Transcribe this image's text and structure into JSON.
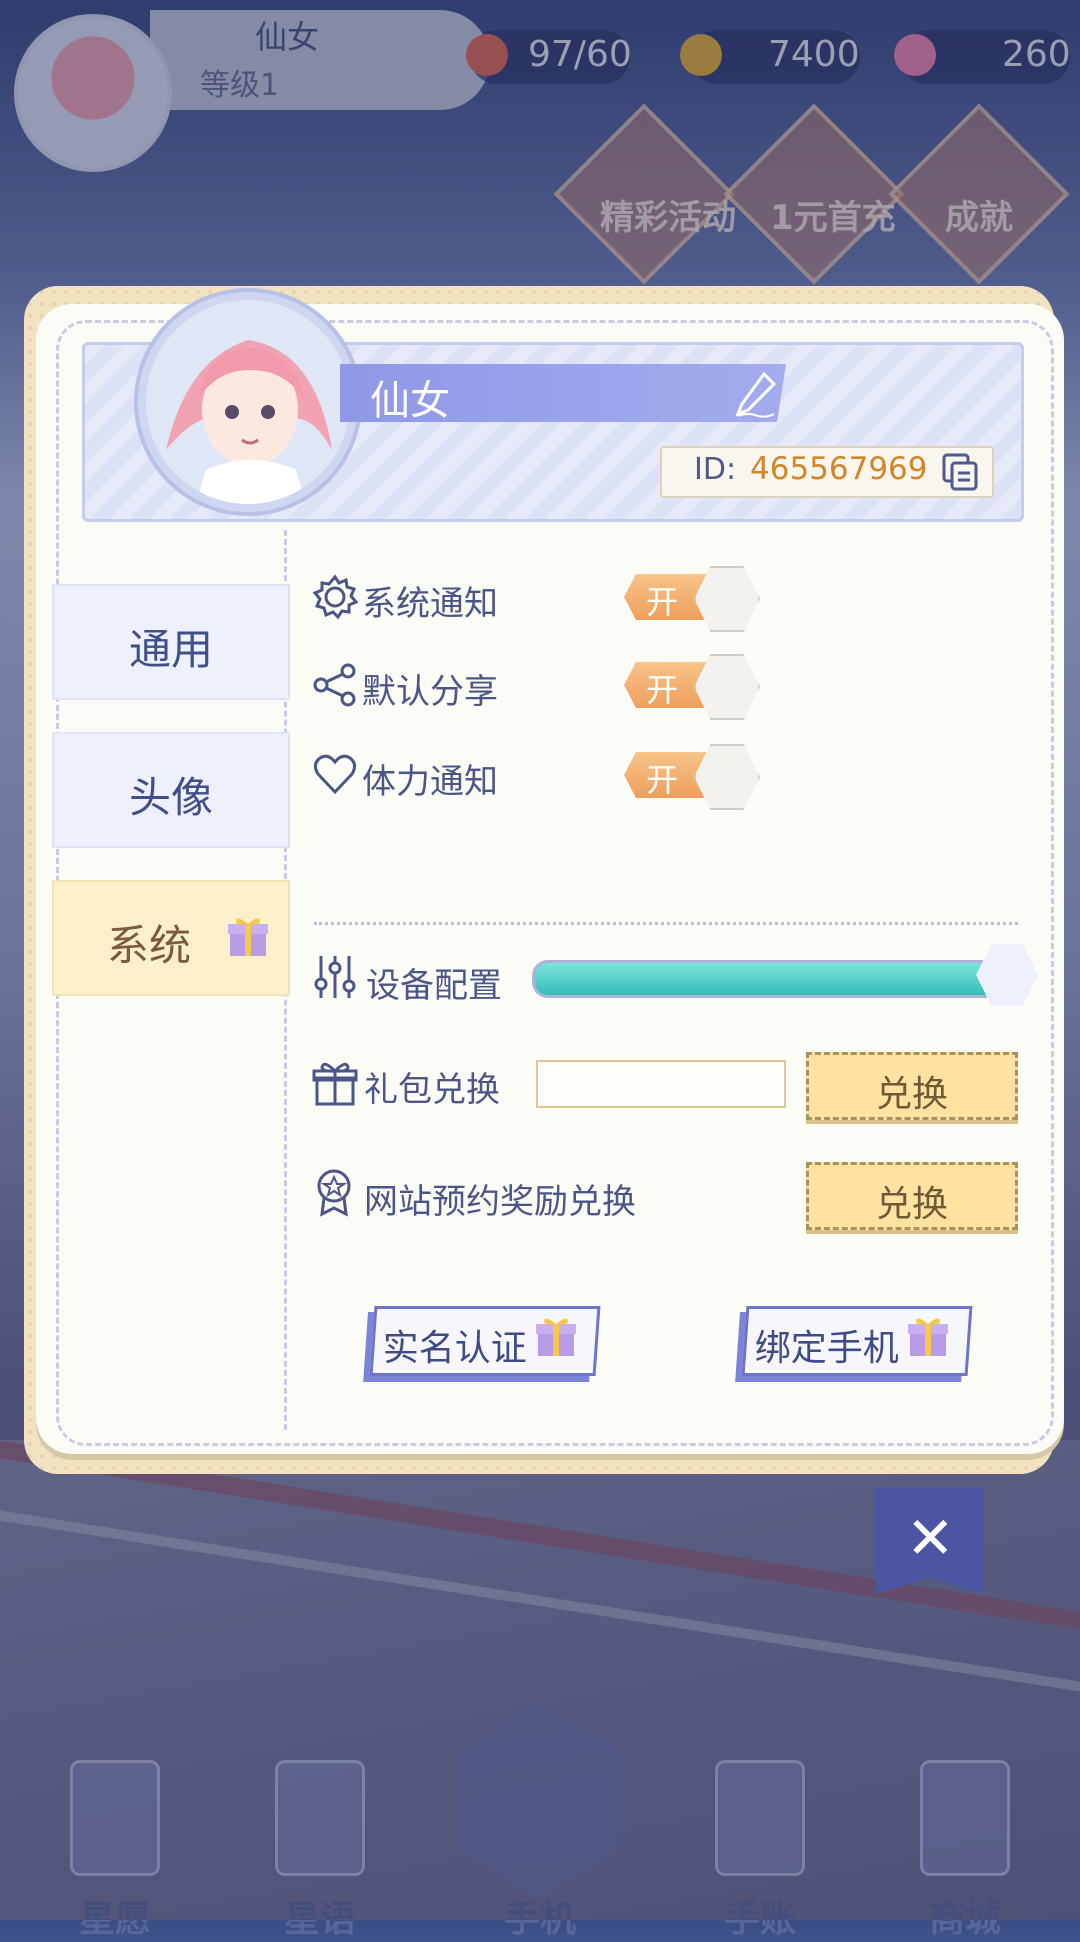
{
  "hud": {
    "player_name": "仙女",
    "player_level": "等级1",
    "stamina": "97/60",
    "coins": "7400",
    "gems": "260",
    "events": [
      "精彩活动",
      "1元首充",
      "成就"
    ]
  },
  "bottom_nav": [
    "星愿",
    "星语",
    "手机",
    "手账",
    "商城"
  ],
  "profile": {
    "name": "仙女",
    "id_label": "ID:",
    "id_value": "465567969"
  },
  "tabs": [
    {
      "label": "通用",
      "active": false
    },
    {
      "label": "头像",
      "active": false
    },
    {
      "label": "系统",
      "active": true
    }
  ],
  "notifications": [
    {
      "label": "系统通知",
      "icon": "gear-icon",
      "state": "开"
    },
    {
      "label": "默认分享",
      "icon": "share-icon",
      "state": "开"
    },
    {
      "label": "体力通知",
      "icon": "heart-icon",
      "state": "开"
    }
  ],
  "device_config": {
    "label": "设备配置",
    "level": 1.0
  },
  "gift_code": {
    "label": "礼包兑换",
    "value": "",
    "button": "兑换"
  },
  "web_reward": {
    "label": "网站预约奖励兑换",
    "button": "兑换"
  },
  "actions": {
    "real_name": "实名认证",
    "bind_phone": "绑定手机"
  },
  "colors": {
    "accent": "#8f98e6",
    "toggle_on": "#ee9f5b",
    "slider": "#34bcb6",
    "id_value": "#d2862b"
  }
}
